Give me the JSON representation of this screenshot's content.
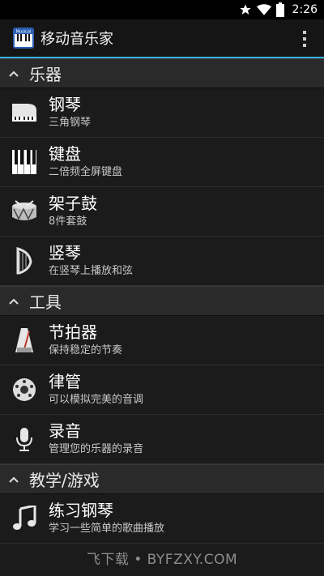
{
  "statusbar": {
    "time": "2:26"
  },
  "actionbar": {
    "app_icon_text": "Musical",
    "title": "移动音乐家"
  },
  "sections": [
    {
      "label": "乐器",
      "items": [
        {
          "title": "钢琴",
          "subtitle": "三角钢琴",
          "icon": "grand-piano-icon"
        },
        {
          "title": "键盘",
          "subtitle": "二倍频全屏键盘",
          "icon": "keyboard-icon"
        },
        {
          "title": "架子鼓",
          "subtitle": "8件套鼓",
          "icon": "drum-icon"
        },
        {
          "title": "竖琴",
          "subtitle": "在竖琴上播放和弦",
          "icon": "harp-icon"
        }
      ]
    },
    {
      "label": "工具",
      "items": [
        {
          "title": "节拍器",
          "subtitle": "保持稳定的节奏",
          "icon": "metronome-icon"
        },
        {
          "title": "律管",
          "subtitle": "可以模拟完美的音调",
          "icon": "pitch-pipe-icon"
        },
        {
          "title": "录音",
          "subtitle": "管理您的乐器的录音",
          "icon": "microphone-icon"
        }
      ]
    },
    {
      "label": "教学/游戏",
      "items": [
        {
          "title": "练习钢琴",
          "subtitle": "学习一些简单的歌曲播放",
          "icon": "music-note-icon"
        }
      ]
    }
  ],
  "watermark": "飞下载 • BYFZXY.COM"
}
